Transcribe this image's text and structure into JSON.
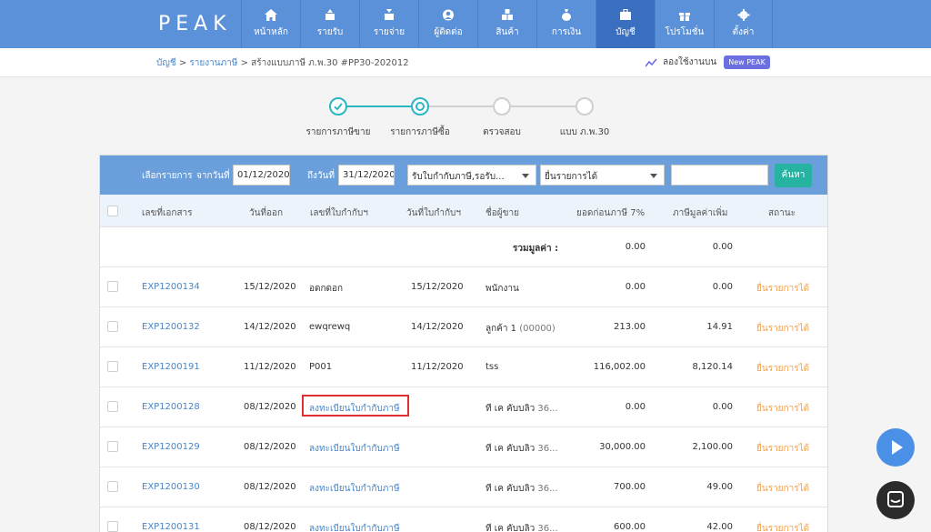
{
  "brand": {
    "logo": "PEAK"
  },
  "nav": [
    {
      "label": "หน้าหลัก",
      "icon": "home-icon"
    },
    {
      "label": "รายรับ",
      "icon": "income-icon"
    },
    {
      "label": "รายจ่าย",
      "icon": "expense-icon"
    },
    {
      "label": "ผู้ติดต่อ",
      "icon": "contact-icon"
    },
    {
      "label": "สินค้า",
      "icon": "product-icon"
    },
    {
      "label": "การเงิน",
      "icon": "money-bag-icon"
    },
    {
      "label": "บัญชี",
      "icon": "briefcase-icon",
      "active": true
    },
    {
      "label": "โปรโมชั่น",
      "icon": "gift-icon"
    },
    {
      "label": "ตั้งค่า",
      "icon": "gear-icon"
    }
  ],
  "breadcrumb": {
    "item1": "บัญชี",
    "sep1": " > ",
    "item2": "รายงานภาษี",
    "sep2": " > ",
    "current": "สร้างแบบภาษี ภ.พ.30 #PP30-202012"
  },
  "try_new": {
    "label": "ลองใช้งานบน",
    "badge": "New PEAK"
  },
  "steps": [
    {
      "label": "รายการภาษีขาย",
      "state": "done"
    },
    {
      "label": "รายการภาษีซื้อ",
      "state": "current"
    },
    {
      "label": "ตรวจสอบ",
      "state": "todo"
    },
    {
      "label": "แบบ ภ.พ.30",
      "state": "todo"
    }
  ],
  "filters": {
    "select_label": "เลือกรายการ",
    "from_label": "จากวันที่",
    "from_value": "01/12/2020",
    "to_label": "ถึงวันที่",
    "to_value": "31/12/2020",
    "doc_type": "รับใบกำกับภาษี,รอรับ...",
    "status": "ยื่นรายการได้",
    "search_value": "",
    "search_button": "ค้นหา"
  },
  "columns": {
    "doc_no": "เลขที่เอกสาร",
    "issue_date": "วันที่ออก",
    "tax_inv_no": "เลขที่ใบกำกับฯ",
    "tax_inv_date": "วันที่ใบกำกับฯ",
    "seller": "ชื่อผู้ขาย",
    "pre_tax": "ยอดก่อนภาษี 7%",
    "vat": "ภาษีมูลค่าเพิ่ม",
    "status": "สถานะ"
  },
  "totals": {
    "label": "รวมมูลค่า :",
    "pre_tax": "0.00",
    "vat": "0.00"
  },
  "rows": [
    {
      "doc_no": "EXP1200134",
      "issue_date": "15/12/2020",
      "tax_inv_no": "อดกดอก",
      "tax_inv_date": "15/12/2020",
      "seller": "พนักงาน",
      "seller_sub": "",
      "pre_tax": "0.00",
      "vat": "0.00",
      "status": "ยื่นรายการได้"
    },
    {
      "doc_no": "EXP1200132",
      "issue_date": "14/12/2020",
      "tax_inv_no": "ewqrewq",
      "tax_inv_date": "14/12/2020",
      "seller": "ลูกค้า 1",
      "seller_sub": " (00000)",
      "pre_tax": "213.00",
      "vat": "14.91",
      "status": "ยื่นรายการได้"
    },
    {
      "doc_no": "EXP1200191",
      "issue_date": "11/12/2020",
      "tax_inv_no": "P001",
      "tax_inv_date": "11/12/2020",
      "seller": "tss",
      "seller_sub": "",
      "pre_tax": "116,002.00",
      "vat": "8,120.14",
      "status": "ยื่นรายการได้"
    },
    {
      "doc_no": "EXP1200128",
      "issue_date": "08/12/2020",
      "tax_inv_no": "ลงทะเบียนใบกำกับภาษี",
      "tax_inv_date": "",
      "seller": "ที เค คับบลิว",
      "seller_sub": " 36...",
      "pre_tax": "0.00",
      "vat": "0.00",
      "status": "ยื่นรายการได้",
      "highlight": true
    },
    {
      "doc_no": "EXP1200129",
      "issue_date": "08/12/2020",
      "tax_inv_no": "ลงทะเบียนใบกำกับภาษี",
      "tax_inv_date": "",
      "seller": "ที เค คับบลิว",
      "seller_sub": " 36...",
      "pre_tax": "30,000.00",
      "vat": "2,100.00",
      "status": "ยื่นรายการได้"
    },
    {
      "doc_no": "EXP1200130",
      "issue_date": "08/12/2020",
      "tax_inv_no": "ลงทะเบียนใบกำกับภาษี",
      "tax_inv_date": "",
      "seller": "ที เค คับบลิว",
      "seller_sub": " 36...",
      "pre_tax": "700.00",
      "vat": "49.00",
      "status": "ยื่นรายการได้"
    },
    {
      "doc_no": "EXP1200131",
      "issue_date": "08/12/2020",
      "tax_inv_no": "ลงทะเบียนใบกำกับภาษี",
      "tax_inv_date": "",
      "seller": "ที เค คับบลิว",
      "seller_sub": " 36...",
      "pre_tax": "600.00",
      "vat": "42.00",
      "status": "ยื่นรายการได้"
    }
  ],
  "colors": {
    "nav_bg": "#5b91d8",
    "nav_active": "#3a6fc0",
    "accent": "#2cb5c2",
    "status": "#f0a04b",
    "link": "#4a86c8",
    "search_btn": "#27b3a2"
  }
}
